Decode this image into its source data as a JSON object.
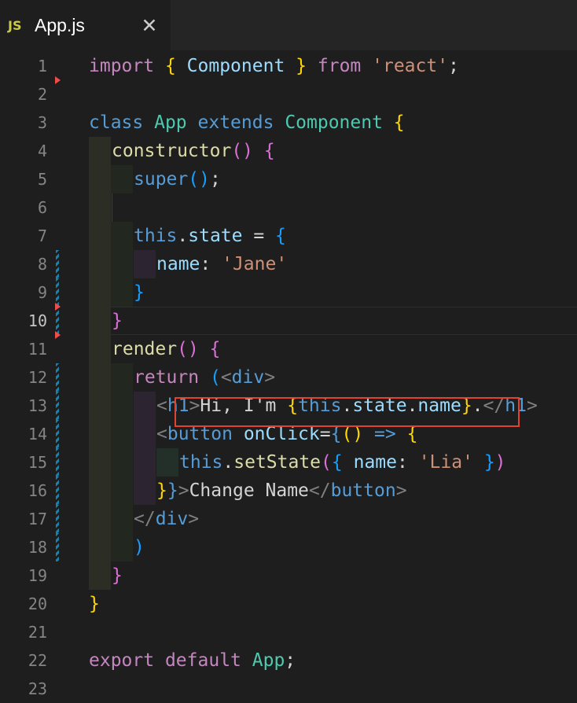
{
  "tab": {
    "icon_label": "JS",
    "title": "App.js",
    "close_glyph": "✕",
    "icon": "close-icon"
  },
  "line_numbers": [
    "1",
    "2",
    "3",
    "4",
    "5",
    "6",
    "7",
    "8",
    "9",
    "10",
    "11",
    "12",
    "13",
    "14",
    "15",
    "16",
    "17",
    "18",
    "19",
    "20",
    "21",
    "22",
    "23"
  ],
  "active_line": "10",
  "code": {
    "l1": {
      "a": "import",
      "b": " ",
      "c": "{",
      "d": " ",
      "e": "Component",
      "f": " ",
      "g": "}",
      "h": " ",
      "i": "from",
      "j": " ",
      "k": "'react'",
      "l": ";"
    },
    "l3": {
      "a": "class",
      "b": " ",
      "c": "App",
      "d": " ",
      "e": "extends",
      "f": " ",
      "g": "Component",
      "h": " ",
      "i": "{"
    },
    "l4": {
      "a": "constructor",
      "b": "()",
      "c": " ",
      "d": "{"
    },
    "l5": {
      "a": "super",
      "b": "()",
      "c": ";"
    },
    "l7": {
      "a": "this",
      "b": ".",
      "c": "state",
      "d": " = ",
      "e": "{"
    },
    "l8": {
      "a": "name",
      "b": ": ",
      "c": "'Jane'"
    },
    "l9": {
      "a": "}"
    },
    "l10": {
      "a": "}"
    },
    "l11": {
      "a": "render",
      "b": "()",
      "c": " ",
      "d": "{"
    },
    "l12": {
      "a": "return",
      "b": " ",
      "c": "(",
      "d": "<",
      "e": "div",
      "f": ">"
    },
    "l13": {
      "a": "<",
      "b": "h1",
      "c": ">",
      "d": "Hi, I'm ",
      "e": "{",
      "f": "this",
      "g": ".",
      "h": "state",
      "i": ".",
      "j": "name",
      "k": "}",
      "l": ".",
      "m": "</",
      "n": "h1",
      "o": ">"
    },
    "l14": {
      "a": "<",
      "b": "button",
      "c": " ",
      "d": "onClick",
      "e": "=",
      "f": "{",
      "g": "()",
      "h": " ",
      "i": "=>",
      "j": " ",
      "k": "{"
    },
    "l15": {
      "a": "this",
      "b": ".",
      "c": "setState",
      "d": "(",
      "e": "{",
      "f": " ",
      "g": "name",
      "h": ": ",
      "i": "'Lia'",
      "j": " ",
      "k": "}",
      "l": ")"
    },
    "l16": {
      "a": "}",
      "b": "}",
      "c": ">",
      "d": "Change Name",
      "e": "</",
      "f": "button",
      "g": ">"
    },
    "l17": {
      "a": "</",
      "b": "div",
      "c": ">"
    },
    "l18": {
      "a": ")"
    },
    "l19": {
      "a": "}"
    },
    "l20": {
      "a": "}"
    },
    "l22": {
      "a": "export",
      "b": " ",
      "c": "default",
      "d": " ",
      "e": "App",
      "f": ";"
    }
  },
  "colors": {
    "keyword": "#c586c0",
    "storage": "#569cd6",
    "class_name": "#4ec9b0",
    "function": "#dcdcaa",
    "string": "#ce9178",
    "property": "#9cdcfe",
    "bracket_1": "#ffd700",
    "bracket_2": "#da70d6",
    "bracket_3": "#179fff",
    "highlight_box": "#e0442e",
    "git_modified": "#1b81a8",
    "git_deleted": "#f14c4c"
  }
}
